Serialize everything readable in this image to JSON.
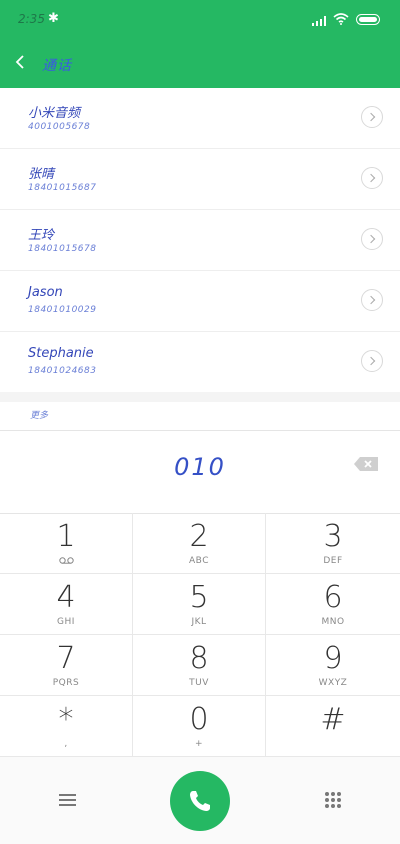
{
  "status_bar": {
    "time": "2:35",
    "bluetooth_icon": "bluetooth-icon",
    "signal_icon": "signal-icon",
    "wifi_icon": "wifi-icon",
    "battery_icon": "battery-icon"
  },
  "header": {
    "back_icon": "back-arrow-icon",
    "title": "通话"
  },
  "contacts": [
    {
      "name": "小米音频",
      "number": "4001005678"
    },
    {
      "name": "张晴",
      "number": "18401015687"
    },
    {
      "name": "王玲",
      "number": "18401015678"
    },
    {
      "name": "Jason",
      "number": "18401010029"
    },
    {
      "name": "Stephanie",
      "number": "18401024683"
    }
  ],
  "section_label": "更多",
  "dial_input": "010",
  "keypad": [
    {
      "digit": "1",
      "letters": ""
    },
    {
      "digit": "2",
      "letters": "ABC"
    },
    {
      "digit": "3",
      "letters": "DEF"
    },
    {
      "digit": "4",
      "letters": "GHI"
    },
    {
      "digit": "5",
      "letters": "JKL"
    },
    {
      "digit": "6",
      "letters": "MNO"
    },
    {
      "digit": "7",
      "letters": "PQRS"
    },
    {
      "digit": "8",
      "letters": "TUV"
    },
    {
      "digit": "9",
      "letters": "WXYZ"
    },
    {
      "digit": "*",
      "letters": ","
    },
    {
      "digit": "0",
      "letters": "+"
    },
    {
      "digit": "#",
      "letters": ""
    }
  ],
  "colors": {
    "accent": "#25b863",
    "handwriting": "#3447b8"
  }
}
